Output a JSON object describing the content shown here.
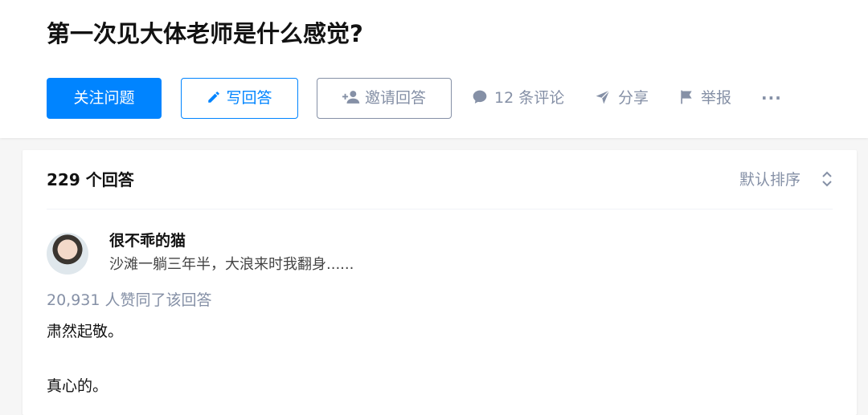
{
  "question": {
    "title": "第一次见大体老师是什么感觉?"
  },
  "actions": {
    "follow_label": "关注问题",
    "write_label": "写回答",
    "invite_label": "邀请回答",
    "comments_label": "12 条评论",
    "share_label": "分享",
    "report_label": "举报",
    "more_label": "···"
  },
  "answers": {
    "count_label": "229 个回答",
    "sort_label": "默认排序"
  },
  "answer": {
    "author_name": "很不乖的猫",
    "author_bio": "沙滩一躺三年半，大浪来时我翻身......",
    "votes_label": "20,931 人赞同了该回答",
    "paragraphs": [
      "肃然起敬。",
      "真心的。"
    ]
  },
  "colors": {
    "brand": "#0084ff",
    "muted": "#8590a6",
    "text": "#121212",
    "background": "#f6f6f6"
  },
  "icons": [
    "pencil-icon",
    "add-person-icon",
    "comment-icon",
    "paper-plane-icon",
    "flag-icon",
    "sort-arrows-icon"
  ]
}
